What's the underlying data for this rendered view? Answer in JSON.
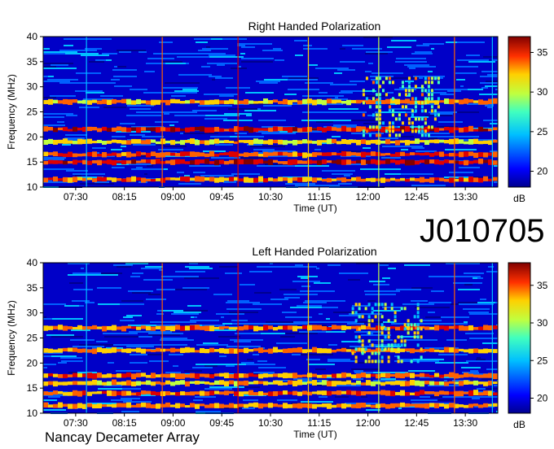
{
  "observation_id": "J010705",
  "instrument": "Nancay Decameter Array",
  "palette": [
    "#00008f",
    "#0000ff",
    "#0060ff",
    "#00c0ff",
    "#40ffbf",
    "#bfff40",
    "#ffcf00",
    "#ff6000",
    "#df0000",
    "#800000"
  ],
  "chart_data": [
    {
      "type": "heatmap",
      "title": "Right Handed Polarization",
      "xlabel": "Time (UT)",
      "ylabel": "Frequency (MHz)",
      "x_ticks": [
        "07:30",
        "08:15",
        "09:00",
        "09:45",
        "10:30",
        "11:15",
        "12:00",
        "12:45",
        "13:30"
      ],
      "ylim": [
        10,
        40
      ],
      "y_ticks": [
        10,
        15,
        20,
        25,
        30,
        35,
        40
      ],
      "colorbar": {
        "label": "dB",
        "range": [
          18,
          37
        ],
        "ticks": [
          20,
          25,
          30,
          35
        ]
      },
      "bands_mhz": [
        {
          "freq": 27.0,
          "level": 31,
          "note": "broad band 07:00-14:00"
        },
        {
          "freq": 21.5,
          "level": 34
        },
        {
          "freq": 19.0,
          "level": 30
        },
        {
          "freq": 16.5,
          "level": 33
        },
        {
          "freq": 15.0,
          "level": 34
        },
        {
          "freq": 11.5,
          "level": 32
        }
      ],
      "burst": {
        "time_start": "11:55",
        "time_end": "13:05",
        "freq_range": [
          20,
          32
        ]
      }
    },
    {
      "type": "heatmap",
      "title": "Left Handed Polarization",
      "xlabel": "Time (UT)",
      "ylabel": "Frequency (MHz)",
      "x_ticks": [
        "07:30",
        "08:15",
        "09:00",
        "09:45",
        "10:30",
        "11:15",
        "12:00",
        "12:45",
        "13:30"
      ],
      "ylim": [
        10,
        40
      ],
      "y_ticks": [
        10,
        15,
        20,
        25,
        30,
        35,
        40
      ],
      "colorbar": {
        "label": "dB",
        "range": [
          18,
          38
        ],
        "ticks": [
          20,
          25,
          30,
          35
        ]
      },
      "bands_mhz": [
        {
          "freq": 27.0,
          "level": 33
        },
        {
          "freq": 22.5,
          "level": 32
        },
        {
          "freq": 17.5,
          "level": 33
        },
        {
          "freq": 16.0,
          "level": 31
        },
        {
          "freq": 14.0,
          "level": 33
        },
        {
          "freq": 11.5,
          "level": 32
        }
      ],
      "burst": {
        "time_start": "11:45",
        "time_end": "12:50",
        "freq_range": [
          20,
          32
        ]
      }
    }
  ]
}
